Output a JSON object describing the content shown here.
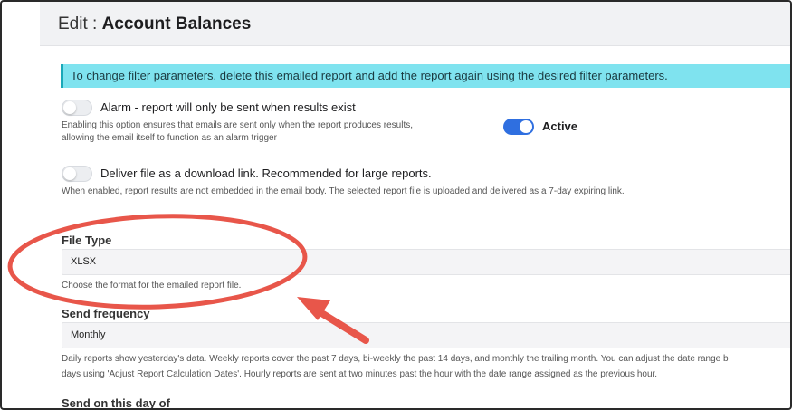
{
  "header": {
    "prefix": "Edit : ",
    "title": "Account Balances"
  },
  "info_banner": "To change filter parameters, delete this emailed report and add the report again using the desired filter parameters.",
  "alarm": {
    "label": "Alarm - report will only be sent when results exist",
    "help_line1": "Enabling this option ensures that emails are sent only when the report produces results,",
    "help_line2": "allowing the email itself to function as an alarm trigger",
    "enabled": false
  },
  "active": {
    "label": "Active",
    "enabled": true,
    "color": "#2f6fe0"
  },
  "download_link": {
    "label": "Deliver file as a download link. Recommended for large reports.",
    "help": "When enabled, report results are not embedded in the email body. The selected report file is uploaded and delivered as a 7-day expiring link.",
    "enabled": false
  },
  "file_type": {
    "label": "File Type",
    "value": "XLSX",
    "help": "Choose the format for the emailed report file."
  },
  "send_frequency": {
    "label": "Send frequency",
    "value": "Monthly",
    "help_line1": "Daily reports show yesterday's data. Weekly reports cover the past 7 days, bi-weekly the past 14 days, and monthly the trailing month. You can adjust the date range b",
    "help_line2": "days using 'Adjust Report Calculation Dates'. Hourly reports are sent at two minutes past the hour with the date range assigned as the previous hour."
  },
  "send_on_day": {
    "label": "Send on this day of"
  },
  "annotation": {
    "color": "#e8564a"
  }
}
